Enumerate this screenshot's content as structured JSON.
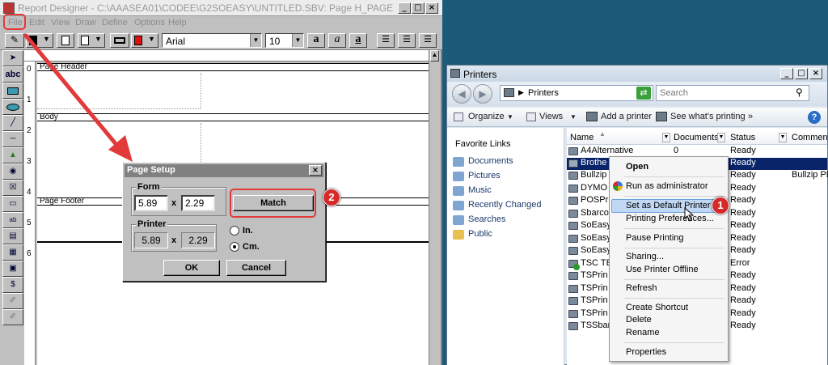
{
  "report_designer": {
    "title": "Report Designer - C:\\AAASEA01\\CODEE\\G2SOEASY\\UNTITLED.SBV: Page H_PAGE",
    "menu": [
      "File",
      "Edit",
      "View",
      "Draw",
      "Define",
      "Options",
      "Help"
    ],
    "font_name": "Arial",
    "font_size": "10",
    "ruler_marks": [
      "0",
      "1",
      "2",
      "3",
      "4",
      "5",
      "6"
    ],
    "bands": {
      "header": "Page Header",
      "body": "Body",
      "footer": "Page Footer"
    },
    "tools": {
      "text_tool": "abc"
    }
  },
  "page_setup": {
    "title": "Page Setup",
    "form_label": "Form",
    "form_width": "5.89",
    "form_height": "2.29",
    "x_sep": "x",
    "match_label": "Match",
    "printer_label": "Printer",
    "printer_width": "5.89",
    "printer_height": "2.29",
    "unit_in": "In.",
    "unit_cm": "Cm.",
    "selected_unit": "Cm.",
    "ok_label": "OK",
    "cancel_label": "Cancel"
  },
  "printers_window": {
    "title": "Printers",
    "address": "Printers",
    "search_placeholder": "Search",
    "commands": [
      "Organize",
      "Views",
      "Add a printer",
      "See what's printing",
      "»"
    ],
    "favorite_links_title": "Favorite Links",
    "favorite_links": [
      "Documents",
      "Pictures",
      "Music",
      "Recently Changed",
      "Searches",
      "Public"
    ],
    "columns": [
      "Name",
      "Documents",
      "Status",
      "Commen"
    ],
    "printers": [
      {
        "name": "A4Alternative",
        "documents": "0",
        "status": "Ready",
        "comment": ""
      },
      {
        "name": "Brothe",
        "documents": "",
        "status": "Ready",
        "comment": ""
      },
      {
        "name": "Bullzip",
        "documents": "",
        "status": "Ready",
        "comment": "Bullzip PD"
      },
      {
        "name": "DYMO",
        "documents": "",
        "status": "Ready",
        "comment": ""
      },
      {
        "name": "POSPri",
        "documents": "",
        "status": "Ready",
        "comment": ""
      },
      {
        "name": "Sbarco",
        "documents": "",
        "status": "Ready",
        "comment": ""
      },
      {
        "name": "SoEasy",
        "documents": "",
        "status": "Ready",
        "comment": ""
      },
      {
        "name": "SoEasy",
        "documents": "",
        "status": "Ready",
        "comment": ""
      },
      {
        "name": "SoEasy",
        "documents": "",
        "status": "Ready",
        "comment": ""
      },
      {
        "name": "TSC TE",
        "documents": "",
        "status": "Error",
        "comment": ""
      },
      {
        "name": "TSPrin",
        "documents": "",
        "status": "Ready",
        "comment": ""
      },
      {
        "name": "TSPrin",
        "documents": "",
        "status": "Ready",
        "comment": ""
      },
      {
        "name": "TSPrin",
        "documents": "",
        "status": "Ready",
        "comment": ""
      },
      {
        "name": "TSPrin",
        "documents": "",
        "status": "Ready",
        "comment": ""
      },
      {
        "name": "TSSbar",
        "documents": "",
        "status": "Ready",
        "comment": ""
      }
    ],
    "context_menu": [
      "Open",
      "Run as administrator",
      "Set as Default Printer",
      "Printing Preferences...",
      "Pause Printing",
      "Sharing...",
      "Use Printer Offline",
      "Refresh",
      "Create Shortcut",
      "Delete",
      "Rename",
      "Properties"
    ]
  },
  "annotations": {
    "step1": "1",
    "step2": "2",
    "accent": "#e23a3a"
  }
}
